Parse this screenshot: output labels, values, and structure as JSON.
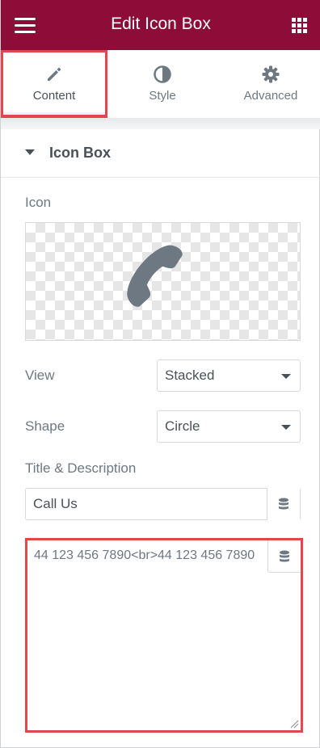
{
  "header": {
    "title": "Edit Icon Box",
    "menu_icon": "hamburger-menu-icon",
    "apps_icon": "grid-apps-icon"
  },
  "tabs": [
    {
      "label": "Content",
      "icon": "pencil-icon",
      "active": true
    },
    {
      "label": "Style",
      "icon": "half-circle-icon",
      "active": false
    },
    {
      "label": "Advanced",
      "icon": "gear-icon",
      "active": false
    }
  ],
  "section": {
    "title": "Icon Box",
    "expanded": true
  },
  "controls": {
    "icon": {
      "label": "Icon",
      "preview_icon": "phone-icon"
    },
    "view": {
      "label": "View",
      "value": "Stacked"
    },
    "shape": {
      "label": "Shape",
      "value": "Circle"
    },
    "title_description": {
      "label": "Title & Description",
      "title_value": "Call Us",
      "description_value": "44 123 456 7890<br>44 123 456 7890"
    }
  },
  "colors": {
    "brand": "#8d0c38",
    "highlight": "#e2474d",
    "text": "#6d7882",
    "icon": "#6d7882"
  }
}
